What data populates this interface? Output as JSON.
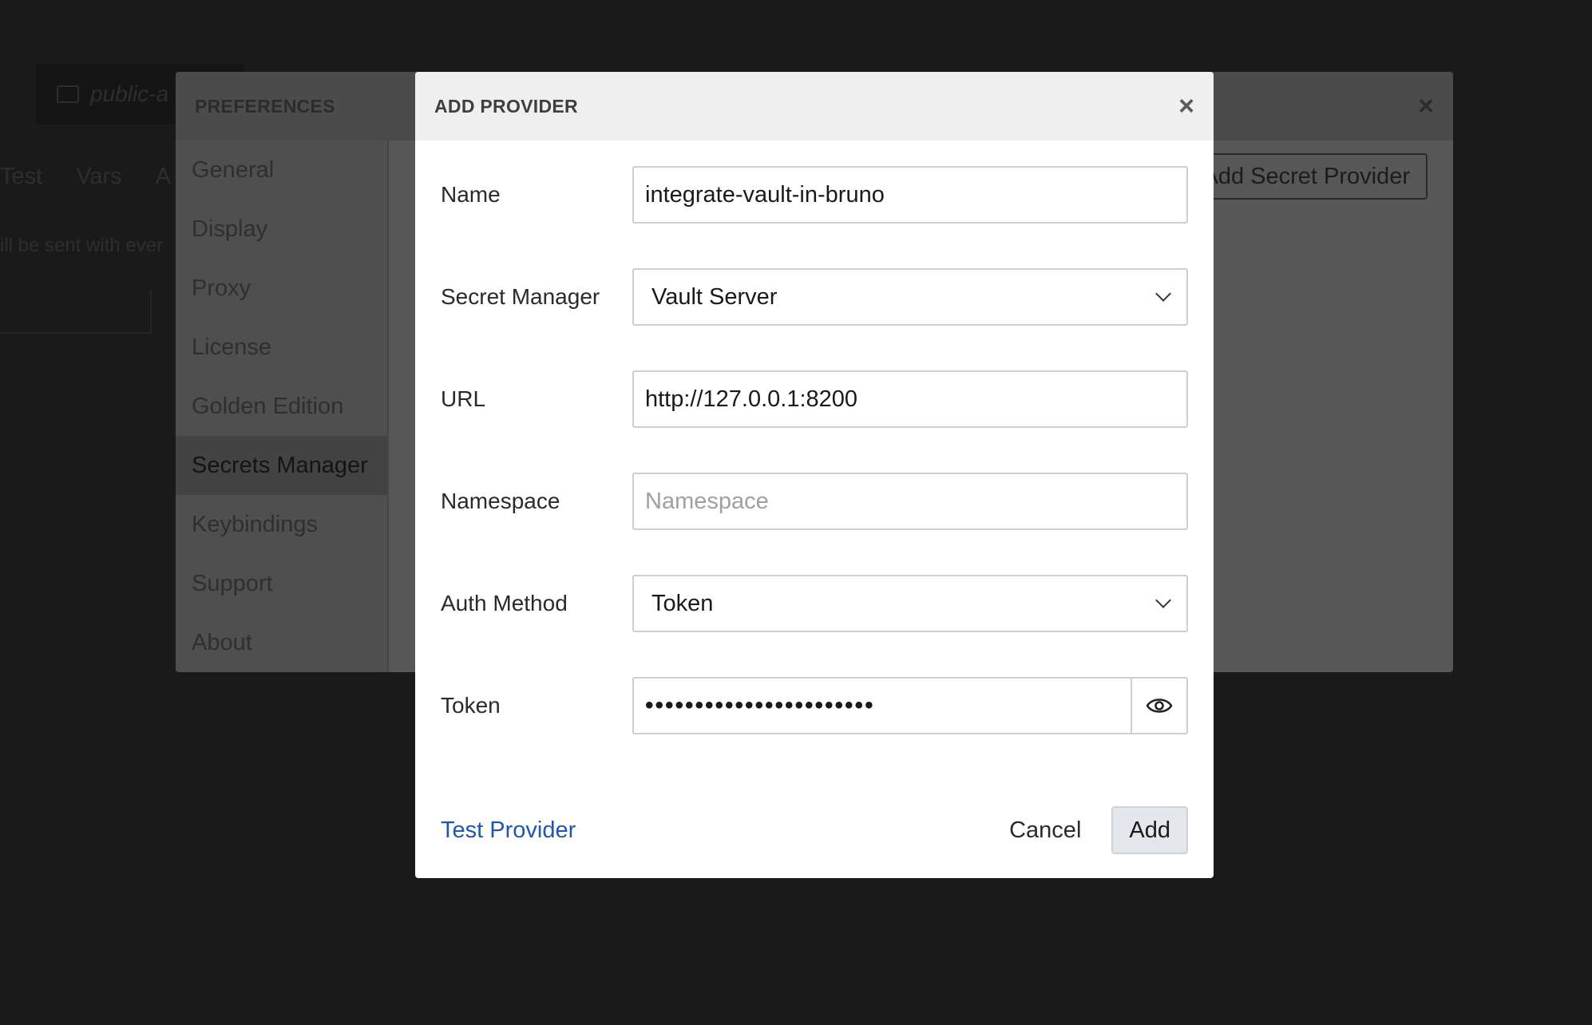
{
  "background": {
    "collection_name": "public-a",
    "tabs": [
      "Test",
      "Vars",
      "A"
    ],
    "note": "ill be sent with ever"
  },
  "preferences": {
    "title": "PREFERENCES",
    "close_icon": "×",
    "sidebar": [
      {
        "label": "General",
        "active": false
      },
      {
        "label": "Display",
        "active": false
      },
      {
        "label": "Proxy",
        "active": false
      },
      {
        "label": "License",
        "active": false
      },
      {
        "label": "Golden Edition",
        "active": false
      },
      {
        "label": "Secrets Manager",
        "active": true
      },
      {
        "label": "Keybindings",
        "active": false
      },
      {
        "label": "Support",
        "active": false
      },
      {
        "label": "About",
        "active": false
      }
    ],
    "add_button_label": "Add Secret Provider"
  },
  "modal": {
    "title": "ADD PROVIDER",
    "close_icon": "×",
    "fields": {
      "name": {
        "label": "Name",
        "value": "integrate-vault-in-bruno"
      },
      "secret_manager": {
        "label": "Secret Manager",
        "value": "Vault Server"
      },
      "url": {
        "label": "URL",
        "value": "http://127.0.0.1:8200"
      },
      "namespace": {
        "label": "Namespace",
        "value": "",
        "placeholder": "Namespace"
      },
      "auth_method": {
        "label": "Auth Method",
        "value": "Token"
      },
      "token": {
        "label": "Token",
        "masked_value": "•••••••••••••••••••••••"
      }
    },
    "footer": {
      "test_label": "Test Provider",
      "cancel_label": "Cancel",
      "add_label": "Add"
    }
  },
  "colors": {
    "page_bg": "#1a1a1a",
    "modal_bg": "#ffffff",
    "header_bg": "#efefef",
    "link": "#1f56b5",
    "add_button_bg": "#e3e6ea"
  },
  "icons": [
    "folder-icon",
    "close-icon",
    "chevron-down-icon",
    "eye-icon"
  ]
}
